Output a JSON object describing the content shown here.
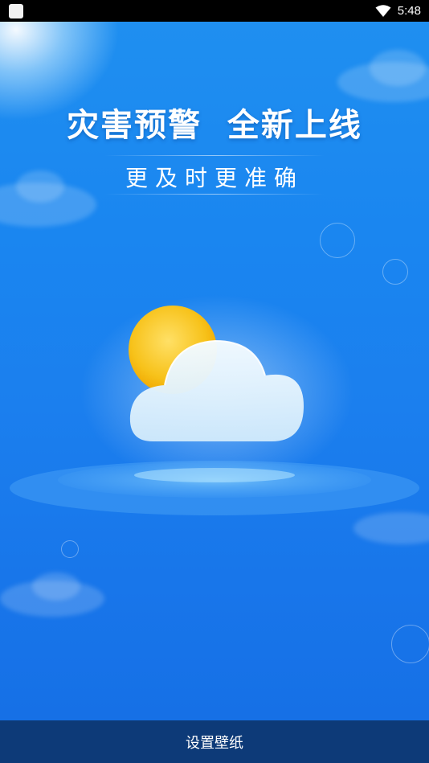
{
  "status_bar": {
    "time": "5:48",
    "app_icon": "app-notification-icon",
    "wifi_icon": "wifi-icon"
  },
  "splash": {
    "title": "灾害预警  全新上线",
    "subtitle": "更及时更准确",
    "illustration": "partly-cloudy-weather-icon"
  },
  "bottom_bar": {
    "set_wallpaper_label": "设置壁纸"
  },
  "colors": {
    "sky_blue": "#1a86f0",
    "bottom_bar": "#0d3a78",
    "sun": "#f7c21a"
  }
}
